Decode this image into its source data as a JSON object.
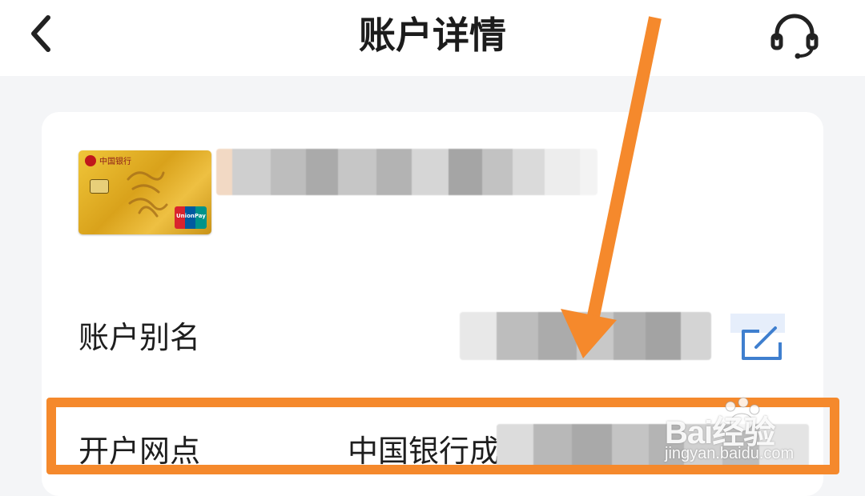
{
  "header": {
    "title": "账户详情",
    "back_icon": "chevron-left-icon",
    "support_icon": "headset-icon"
  },
  "card": {
    "bank_name": "中国银行",
    "network": "UnionPay",
    "network_cn": "银联"
  },
  "rows": {
    "alias": {
      "label": "账户别名",
      "edit_icon": "edit-icon"
    },
    "branch": {
      "label": "开户网点",
      "value": "中国银行成"
    }
  },
  "watermark": {
    "brand": "Bai经验",
    "site": "jingyan.baidu.com"
  },
  "colors": {
    "accent": "#f5892c",
    "edit_icon": "#3f7fcf",
    "card_gold": "#e2b12c",
    "background": "#f4f5f7"
  }
}
